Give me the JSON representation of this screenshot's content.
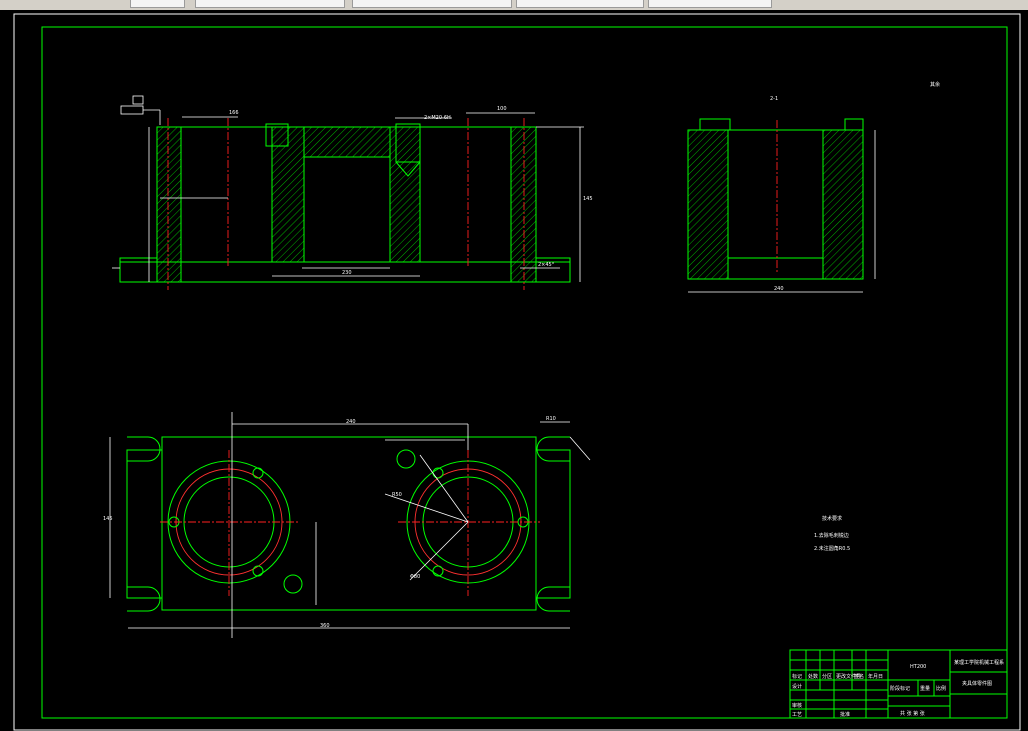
{
  "toolbar": {
    "tabs": [
      "",
      "",
      "",
      "",
      ""
    ]
  },
  "drawing": {
    "section_label": "2-1",
    "roughness_note": "其余",
    "notes": {
      "title": "技术要求",
      "line1": "1.去除毛刺锐边",
      "line2": "2.未注圆角R0.5"
    },
    "title_block": {
      "material": "HT200",
      "school": "某理工学院机械工程系",
      "part_name": "夹具体零件图",
      "rows": [
        "标记",
        "处数",
        "分区",
        "更改文件号",
        "签名",
        "年月日"
      ],
      "design": "设计",
      "check": "审核",
      "process": "工艺",
      "approve": "批准",
      "stage": "阶段标记",
      "weight": "重量",
      "scale": "比例",
      "sheet": "共 张 第 张"
    },
    "dims": {
      "top_width": "166",
      "chamfer": "2×45°",
      "thread": "2×M20-6H",
      "side_width": "100",
      "base_width": "230",
      "plan_width": "360",
      "plan_height": "145",
      "plan_center": "240",
      "radius": "R50",
      "slot": "R10",
      "hole": "Φ80"
    }
  }
}
